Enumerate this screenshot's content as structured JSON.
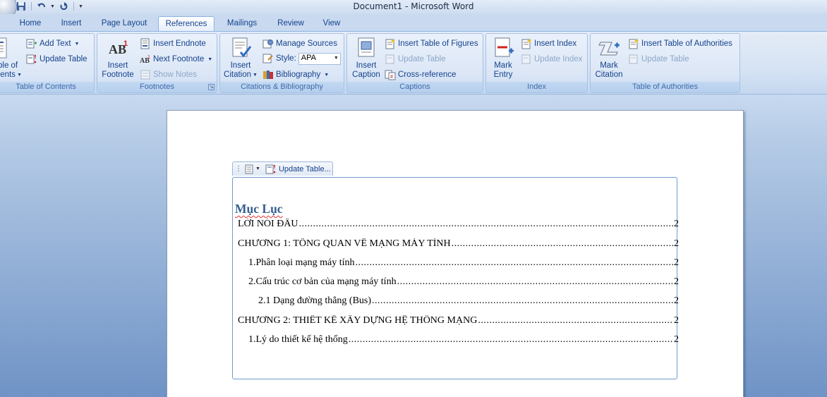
{
  "window": {
    "title": "Document1 - Microsoft Word"
  },
  "tabs": [
    {
      "label": "Home",
      "active": false
    },
    {
      "label": "Insert",
      "active": false
    },
    {
      "label": "Page Layout",
      "active": false
    },
    {
      "label": "References",
      "active": true
    },
    {
      "label": "Mailings",
      "active": false
    },
    {
      "label": "Review",
      "active": false
    },
    {
      "label": "View",
      "active": false
    }
  ],
  "ribbon": {
    "toc": {
      "label": "Table of Contents",
      "big_label_1": "ble of",
      "big_label_2": "tents",
      "add_text": "Add Text",
      "update_table": "Update Table"
    },
    "footnotes": {
      "label": "Footnotes",
      "insert_footnote_1": "Insert",
      "insert_footnote_2": "Footnote",
      "insert_endnote": "Insert Endnote",
      "next_footnote": "Next Footnote",
      "show_notes": "Show Notes"
    },
    "citations": {
      "label": "Citations & Bibliography",
      "insert_citation_1": "Insert",
      "insert_citation_2": "Citation",
      "manage_sources": "Manage Sources",
      "style_label": "Style:",
      "style_value": "APA",
      "bibliography": "Bibliography"
    },
    "captions": {
      "label": "Captions",
      "insert_caption_1": "Insert",
      "insert_caption_2": "Caption",
      "insert_table_of_figures": "Insert Table of Figures",
      "update_table": "Update Table",
      "cross_reference": "Cross-reference"
    },
    "index": {
      "label": "Index",
      "mark_entry_1": "Mark",
      "mark_entry_2": "Entry",
      "insert_index": "Insert Index",
      "update_index": "Update Index"
    },
    "authorities": {
      "label": "Table of Authorities",
      "mark_citation_1": "Mark",
      "mark_citation_2": "Citation",
      "insert_table_of_authorities": "Insert Table of Authorities",
      "update_table": "Update Table"
    }
  },
  "document": {
    "toc_toolbar": {
      "update_table": "Update Table..."
    },
    "toc_title": "Mục Lục",
    "entries": [
      {
        "text": "LỜI NÓI ĐẦU",
        "page": "2"
      },
      {
        "text": "CHƯƠNG 1: TỔNG QUAN VỀ MẠNG MÁY TÍNH",
        "page": "2"
      },
      {
        "text": "1.Phân loại mạng máy tính",
        "page": "2"
      },
      {
        "text": "2.Cấu trúc cơ bản của mạng máy tính",
        "page": "2"
      },
      {
        "text": "2.1 Dạng đường thẳng (Bus)",
        "page": "2"
      },
      {
        "text": "CHƯƠNG 2: THIẾT KẾ XÂY DỰNG HỆ THỐNG MẠNG",
        "page": "2"
      },
      {
        "text": "1.Lý  do thiết kế hệ thống",
        "page": "2"
      }
    ]
  }
}
